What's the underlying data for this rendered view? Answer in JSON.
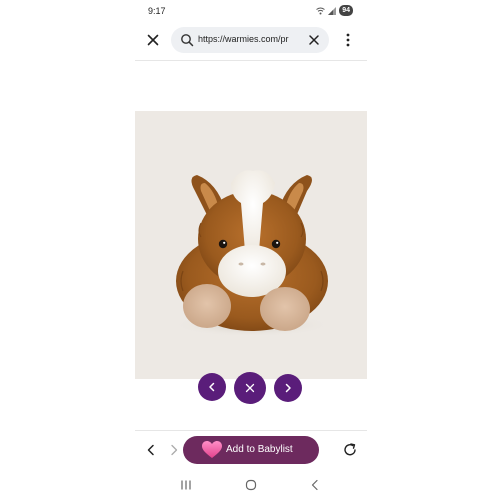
{
  "status_bar": {
    "time": "9:17",
    "battery": "94"
  },
  "browser": {
    "url": "https://warmies.com/pr",
    "icons": [
      "close-icon",
      "search-icon",
      "clear-icon",
      "more-vert-icon"
    ]
  },
  "gallery": {
    "image_alt": "Warmies plush horse",
    "controls": [
      "chevron-left-icon",
      "close-icon",
      "chevron-right-icon"
    ],
    "accent_color": "#5a1d7a"
  },
  "toolbar": {
    "babylist_label": "Add to Babylist",
    "babylist_color": "#6d2a5e",
    "icons": [
      "back-icon",
      "forward-icon",
      "heart-icon",
      "refresh-icon"
    ]
  },
  "system_nav": {
    "icons": [
      "recents-icon",
      "home-icon",
      "back-icon"
    ]
  }
}
